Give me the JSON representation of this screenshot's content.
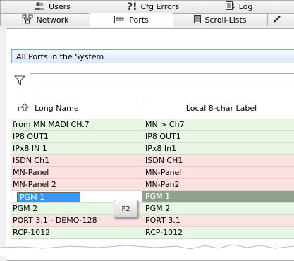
{
  "tabs_row1": [
    {
      "label": "Users",
      "icon": "users-icon"
    },
    {
      "label": "Cfg Errors",
      "prefix": "?!",
      "icon": "cfg-errors-icon"
    },
    {
      "label": "Log",
      "icon": "log-icon"
    }
  ],
  "tabs_row2": [
    {
      "label": "Network",
      "icon": "network-icon"
    },
    {
      "label": "Ports",
      "icon": "ports-icon",
      "active": true
    },
    {
      "label": "Scroll-Lists",
      "icon": "scroll-lists-icon"
    }
  ],
  "selector": {
    "value": "All Ports in the System"
  },
  "filter": {
    "value": ""
  },
  "grid": {
    "sort_arrow": "1",
    "col1_header": "Long Name",
    "col2_header": "Local 8-char Label",
    "rows": [
      {
        "name": "from MN MADI CH.7",
        "label": "MN > Ch7",
        "color": "green"
      },
      {
        "name": "IP8 OUT1",
        "label": "IP8 OUT1",
        "color": "green"
      },
      {
        "name": "IPx8 IN 1",
        "label": "IPx8 In1",
        "color": "green"
      },
      {
        "name": "ISDN Ch1",
        "label": "ISDN CH1",
        "color": "pink"
      },
      {
        "name": "MN-Panel",
        "label": "MN-Panel",
        "color": "pink"
      },
      {
        "name": "MN-Panel 2",
        "label": "MN-Pan2",
        "color": "pink"
      },
      {
        "name": "PGM 1",
        "label": "PGM 1",
        "color": "selected"
      },
      {
        "name": "PGM 2",
        "label": "PGM 2",
        "color": "green"
      },
      {
        "name": "PORT 3.1 - DEMO-128",
        "label": "PORT 3.1",
        "color": "pink"
      },
      {
        "name": "RCP-1012",
        "label": "RCP-1012",
        "color": "green"
      }
    ]
  },
  "keycap": {
    "label": "F2"
  }
}
